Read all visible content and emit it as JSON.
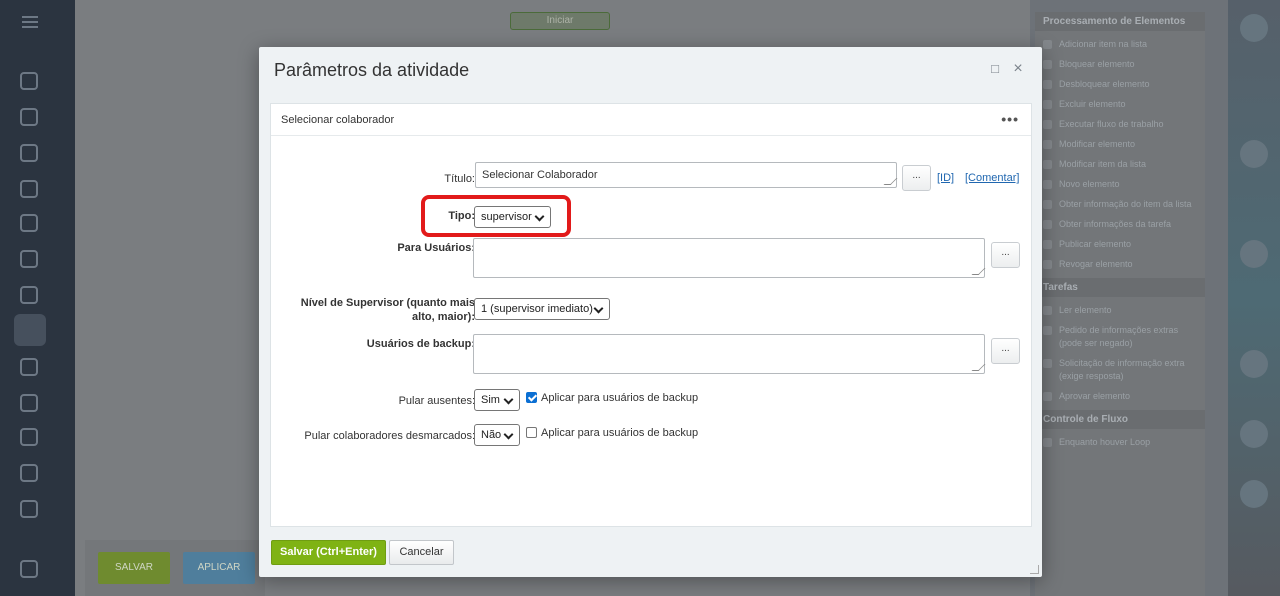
{
  "background": {
    "start_node": "Iniciar",
    "save_label": "SALVAR",
    "apply_label": "APLICAR",
    "panel_groups": [
      {
        "title": "Processamento de Elementos",
        "items": [
          "Adicionar item na lista",
          "Bloquear elemento",
          "Desbloquear elemento",
          "Excluir elemento",
          "Executar fluxo de trabalho",
          "Modificar elemento",
          "Modificar item da lista",
          "Novo elemento",
          "Obter informação do item da lista",
          "Obter informações da tarefa",
          "Publicar elemento",
          "Revogar elemento"
        ]
      },
      {
        "title": "Tarefas",
        "items": [
          "Ler elemento",
          "Pedido de informações extras (pode ser negado)",
          "Solicitação de informação extra (exige resposta)",
          "Aprovar elemento"
        ]
      },
      {
        "title": "Controle de Fluxo",
        "items": [
          "Enquanto houver Loop"
        ]
      }
    ]
  },
  "modal": {
    "title": "Parâmetros da atividade",
    "maximize_icon": "□",
    "close_icon": "×",
    "section_title": "Selecionar colaborador",
    "more_icon": "•••",
    "form": {
      "titulo_label": "Título:",
      "titulo_value": "Selecionar Colaborador",
      "browse_label": "...",
      "id_link": "[ID]",
      "comment_link": "[Comentar]",
      "tipo_label": "Tipo:",
      "tipo_value": "supervisor",
      "para_usuarios_label": "Para Usuários:",
      "para_usuarios_value": "",
      "nivel_label_1": "Nível de Supervisor (quanto mais",
      "nivel_label_2": "alto, maior):",
      "nivel_value": "1 (supervisor imediato)",
      "backup_label": "Usuários de backup:",
      "backup_value": "",
      "pular_ausentes_label": "Pular ausentes:",
      "pular_ausentes_value": "Sim",
      "pular_ausentes_cb_label": "Aplicar para usuários de backup",
      "pular_ausentes_cb_checked": true,
      "pular_desmarcados_label": "Pular colaboradores desmarcados:",
      "pular_desmarcados_value": "Não",
      "pular_desmarcados_cb_label": "Aplicar para usuários de backup",
      "pular_desmarcados_cb_checked": false
    },
    "save_button": "Salvar (Ctrl+Enter)",
    "cancel_button": "Cancelar"
  },
  "colors": {
    "accent_green": "#7fb314",
    "highlight_red": "#e21a1a",
    "link_blue": "#2067b0"
  }
}
